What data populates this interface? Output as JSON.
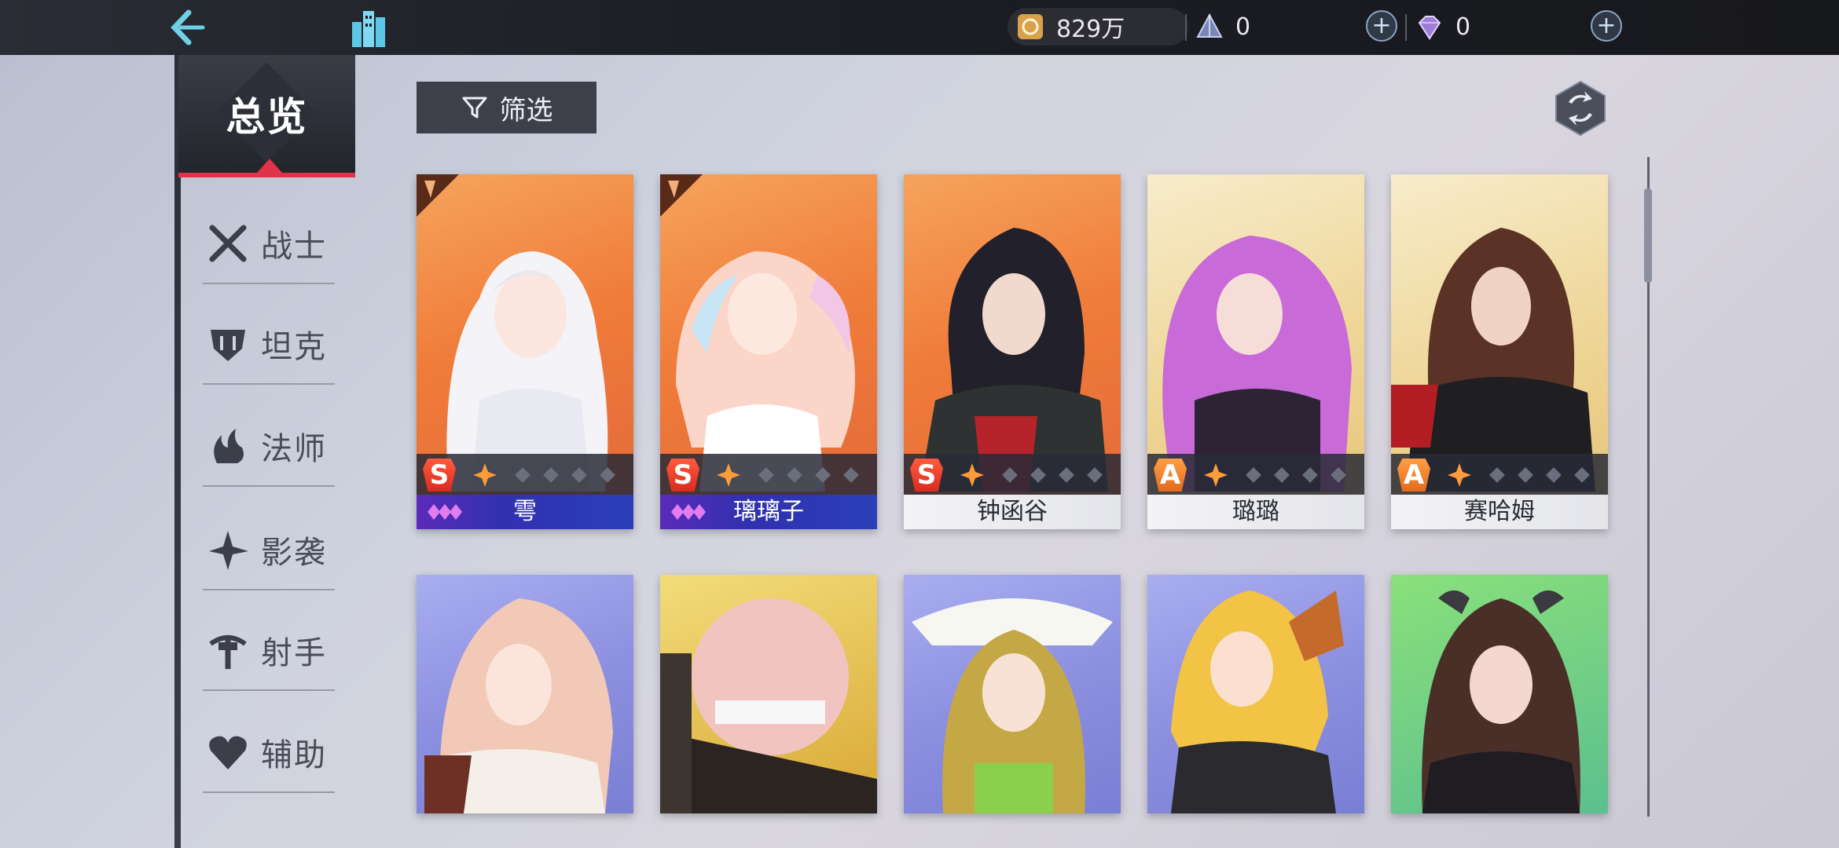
{
  "topbar": {
    "back_icon": "back-chevron-icon",
    "city_icon": "city-building-icon",
    "resources": [
      {
        "icon": "gold-coin-icon",
        "value": "829万"
      },
      {
        "icon": "crystal-pyramid-icon",
        "value": "0"
      },
      {
        "icon": "diamond-gem-icon",
        "value": "0"
      }
    ]
  },
  "sidebar": {
    "active": "总览",
    "categories": [
      {
        "label": "战士",
        "icon": "crossed-swords-icon"
      },
      {
        "label": "坦克",
        "icon": "shield-helmet-icon"
      },
      {
        "label": "法师",
        "icon": "magic-flame-icon"
      },
      {
        "label": "影袭",
        "icon": "shuriken-blade-icon"
      },
      {
        "label": "射手",
        "icon": "crossbow-icon"
      },
      {
        "label": "辅助",
        "icon": "heart-icon"
      }
    ]
  },
  "toolbar": {
    "filter_label": "筛选",
    "refresh_icon": "refresh-cycle-icon"
  },
  "cards_row1": [
    {
      "name": "雩",
      "rank": "S",
      "stars": 1,
      "rarity": "UR"
    },
    {
      "name": "璃璃子",
      "rank": "S",
      "stars": 1,
      "rarity": "UR"
    },
    {
      "name": "钟函谷",
      "rank": "S",
      "stars": 1,
      "rarity": "normal"
    },
    {
      "name": "璐璐",
      "rank": "A",
      "stars": 1,
      "rarity": "normal"
    },
    {
      "name": "赛哈姆",
      "rank": "A",
      "stars": 1,
      "rarity": "normal"
    }
  ],
  "colors": {
    "accent": "#e0344a",
    "dark_panel": "#3d404b"
  }
}
